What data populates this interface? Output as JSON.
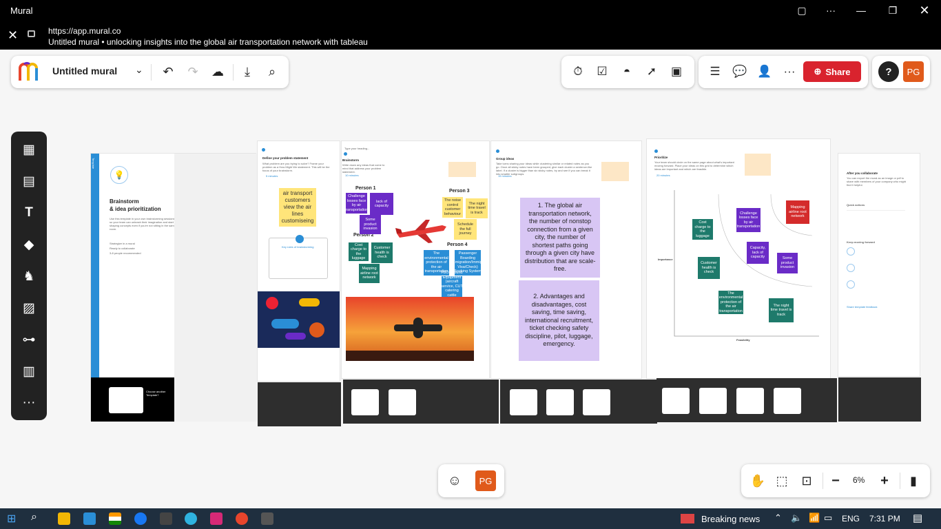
{
  "window": {
    "title": "Mural"
  },
  "urlbar": {
    "url": "https://app.mural.co",
    "page_title": "Untitled mural • unlocking insights into the global air transportation network with tableau"
  },
  "toolbar": {
    "mural_name": "Untitled mural",
    "share_label": "Share",
    "avatar_initials": "PG"
  },
  "bottom": {
    "avatar_initials": "PG",
    "zoom": "6%"
  },
  "colors": {
    "share": "#d9232e",
    "avatar": "#e05a1b",
    "teal": "#1e7a6b",
    "purple": "#6a2bc7"
  },
  "icons": [
    "mural-logo-icon",
    "chevron-down-icon",
    "undo-icon",
    "redo-icon",
    "cloud-check-icon",
    "download-icon",
    "search-icon",
    "timer-icon",
    "checkbox-icon",
    "incognito-icon",
    "cursor-icon",
    "toolbox-icon",
    "outline-icon",
    "comment-icon",
    "person-icon",
    "more-icon",
    "share-icon",
    "help-icon",
    "emoji-icon",
    "hand-icon",
    "select-icon",
    "map-icon",
    "minus-icon",
    "plus-icon",
    "panel-icon"
  ],
  "board": {
    "brainstorm": {
      "tag": "Template",
      "title": "Brainstorm\n& idea prioritization",
      "desc": "Use this template in your own brainstorming sessions so your team can unleash their imagination and start shaping concepts even if you're not sitting in the same room.",
      "items": [
        "Strategize in a mural",
        "Ready to collaborate",
        "3-8 people recommended"
      ],
      "footer": "Choose another Template?"
    },
    "define": {
      "title": "Define your problem statement",
      "desc": "What problem are you trying to solve? Frame your problem as a How Might We statement. This will be the focus of your brainstorm.",
      "time": "5 minutes",
      "sticky": "air transport customers view the air lines customiseing",
      "rules_title": "Key rules of brainstorming"
    },
    "brainstorm_area": {
      "typing": "Type your heading...",
      "title": "Brainstorm",
      "desc": "Write down any ideas that come to mind that address your problem statement.",
      "time": "10 minutes",
      "person1": "Person 1",
      "person2": "Person 2",
      "person3": "Person 3",
      "person4": "Person 4",
      "notes": {
        "challenge": "Challenge losses face by air transportation",
        "lack": "lack of capacity",
        "some": "Some product invasion",
        "cost": "Cost charge to the luggage",
        "health": "Customer health is check",
        "mapping": "Mapping airline root network",
        "noise": "The noise control customer behaviour",
        "night": "The night time travel is track",
        "schedule": "Schedule the full journey",
        "env": "The environmental protection of the air transportation",
        "passenger": "Passenger Boarding (Emigration/Immigr, Visa/Check) Booking System",
        "fbo": "FBO Ground Equipment (aircraft service, CUT catering cattle management"
      }
    },
    "group": {
      "title": "Group ideas",
      "desc": "Take turns sharing your ideas while clustering similar or related notes as you go. Once all sticky notes have been grouped, give each cluster a sentence-like label. If a cluster is bigger than six sticky notes, try and see if you can break it into smaller subgroups.",
      "time": "15 minutes",
      "p1": "1. The global air transportation network, the number of nonstop connection from a given city, the number of shortest paths going through a given city have distribution that are scale-free.",
      "p2": "2. Advantages and disadvantages, cost saving, time saving, international recruitment, ticket checking safety discipline, pilot, luggage, emergency."
    },
    "prioritize": {
      "title": "Prioritize",
      "desc": "Your team should circle on the same page about what's important moving forward. Place your ideas on this grid to determine which ideas are important and which are feasible.",
      "time": "20 minutes",
      "y_label": "Importance",
      "x_label": "Feasibility",
      "notes": {
        "challenge": "Challenge losses face by air transportation",
        "mapping": "Mapping airline root network",
        "cost": "Cost charge to the luggage",
        "capacity": "Capacity, lack of capacity",
        "some": "Some product invasion",
        "health": "Customer health is check",
        "env": "The environmental protection of the air transportation",
        "night": "The night time travel is track"
      }
    },
    "after": {
      "title": "After you collaborate",
      "desc": "You can export the mural as an image or pdf to share with members of your company who might find it helpful.",
      "quick": "Quick actions",
      "moving": "Keep moving forward",
      "share": "Share template feedback"
    }
  },
  "taskbar": {
    "news": "Breaking news",
    "lang": "ENG",
    "time": "7:31 PM"
  }
}
